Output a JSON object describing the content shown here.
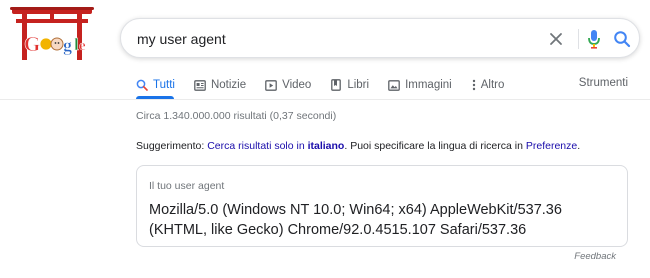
{
  "logo": {
    "text": "Google",
    "kind": "doodle-with-torii-gate"
  },
  "search": {
    "query": "my user agent",
    "placeholder": ""
  },
  "icons": {
    "clear": "close-icon",
    "mic": "microphone-icon",
    "search": "magnifier-icon"
  },
  "tabs": [
    {
      "label": "Tutti",
      "icon": "search-icon",
      "active": true
    },
    {
      "label": "Notizie",
      "icon": "news-icon",
      "active": false
    },
    {
      "label": "Video",
      "icon": "video-icon",
      "active": false
    },
    {
      "label": "Libri",
      "icon": "book-icon",
      "active": false
    },
    {
      "label": "Immagini",
      "icon": "image-icon",
      "active": false
    },
    {
      "label": "Altro",
      "icon": "more-vertical-icon",
      "active": false
    }
  ],
  "tools_label": "Strumenti",
  "stats": "Circa 1.340.000.000 risultati (0,37 secondi)",
  "suggestion": {
    "prefix": "Suggerimento:",
    "link1": "Cerca risultati solo in",
    "link1_bold": "italiano",
    "middle": ". Puoi specificare la lingua di ricerca in",
    "link2": "Preferenze",
    "suffix": "."
  },
  "ua_card": {
    "label": "Il tuo user agent",
    "value": "Mozilla/5.0 (Windows NT 10.0; Win64; x64) AppleWebKit/537.36 (KHTML, like Gecko) Chrome/92.0.4515.107 Safari/537.36"
  },
  "feedback": "Feedback",
  "colors": {
    "accent": "#1a73e8",
    "link": "#1a0dab",
    "muted": "#70757a",
    "border": "#dadce0"
  }
}
